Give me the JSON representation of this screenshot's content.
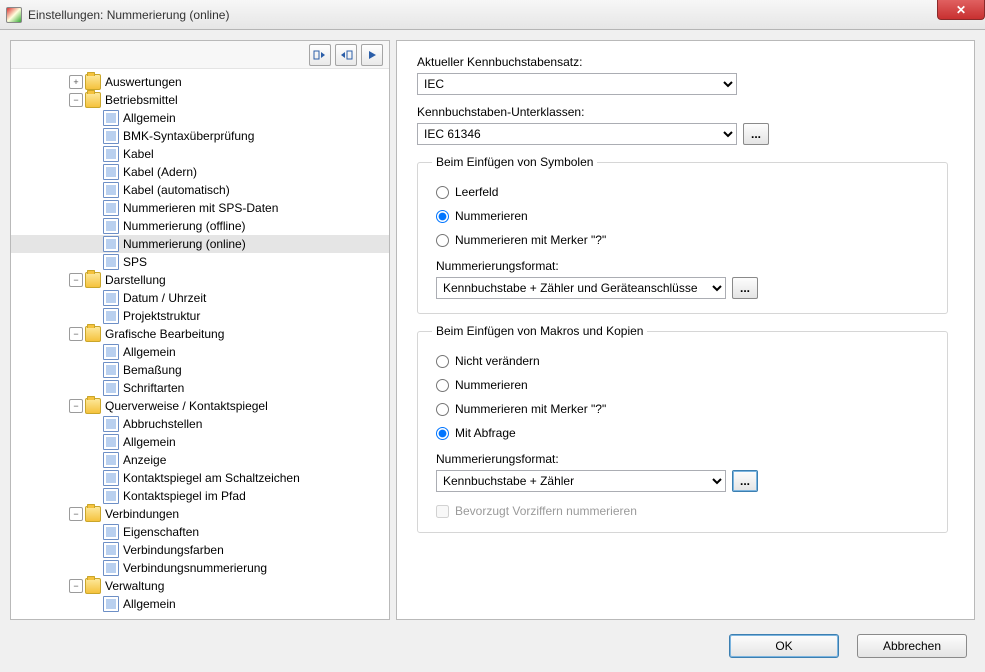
{
  "window": {
    "title": "Einstellungen: Nummerierung (online)",
    "close": "✕"
  },
  "footer": {
    "ok": "OK",
    "cancel": "Abbrechen"
  },
  "tree": [
    {
      "d": 0,
      "tgl": "+",
      "ico": "folder",
      "label": "Auswertungen"
    },
    {
      "d": 0,
      "tgl": "-",
      "ico": "folder",
      "label": "Betriebsmittel"
    },
    {
      "d": 1,
      "tgl": "",
      "ico": "item",
      "label": "Allgemein"
    },
    {
      "d": 1,
      "tgl": "",
      "ico": "item",
      "label": "BMK-Syntaxüberprüfung"
    },
    {
      "d": 1,
      "tgl": "",
      "ico": "item",
      "label": "Kabel"
    },
    {
      "d": 1,
      "tgl": "",
      "ico": "item",
      "label": "Kabel (Adern)"
    },
    {
      "d": 1,
      "tgl": "",
      "ico": "item",
      "label": "Kabel (automatisch)"
    },
    {
      "d": 1,
      "tgl": "",
      "ico": "item",
      "label": "Nummerieren mit SPS-Daten"
    },
    {
      "d": 1,
      "tgl": "",
      "ico": "item",
      "label": "Nummerierung (offline)"
    },
    {
      "d": 1,
      "tgl": "",
      "ico": "item",
      "label": "Nummerierung (online)",
      "sel": true
    },
    {
      "d": 1,
      "tgl": "",
      "ico": "item",
      "label": "SPS"
    },
    {
      "d": 0,
      "tgl": "-",
      "ico": "folder",
      "label": "Darstellung"
    },
    {
      "d": 1,
      "tgl": "",
      "ico": "item",
      "label": "Datum / Uhrzeit"
    },
    {
      "d": 1,
      "tgl": "",
      "ico": "item",
      "label": "Projektstruktur"
    },
    {
      "d": 0,
      "tgl": "-",
      "ico": "folder",
      "label": "Grafische Bearbeitung"
    },
    {
      "d": 1,
      "tgl": "",
      "ico": "item",
      "label": "Allgemein"
    },
    {
      "d": 1,
      "tgl": "",
      "ico": "item",
      "label": "Bemaßung"
    },
    {
      "d": 1,
      "tgl": "",
      "ico": "item",
      "label": "Schriftarten"
    },
    {
      "d": 0,
      "tgl": "-",
      "ico": "folder",
      "label": "Querverweise / Kontaktspiegel"
    },
    {
      "d": 1,
      "tgl": "",
      "ico": "item",
      "label": "Abbruchstellen"
    },
    {
      "d": 1,
      "tgl": "",
      "ico": "item",
      "label": "Allgemein"
    },
    {
      "d": 1,
      "tgl": "",
      "ico": "item",
      "label": "Anzeige"
    },
    {
      "d": 1,
      "tgl": "",
      "ico": "item",
      "label": "Kontaktspiegel am Schaltzeichen"
    },
    {
      "d": 1,
      "tgl": "",
      "ico": "item",
      "label": "Kontaktspiegel im Pfad"
    },
    {
      "d": 0,
      "tgl": "-",
      "ico": "folder",
      "label": "Verbindungen"
    },
    {
      "d": 1,
      "tgl": "",
      "ico": "item",
      "label": "Eigenschaften"
    },
    {
      "d": 1,
      "tgl": "",
      "ico": "item",
      "label": "Verbindungsfarben"
    },
    {
      "d": 1,
      "tgl": "",
      "ico": "item",
      "label": "Verbindungsnummerierung"
    },
    {
      "d": 0,
      "tgl": "-",
      "ico": "folder",
      "label": "Verwaltung"
    },
    {
      "d": 1,
      "tgl": "",
      "ico": "item",
      "label": "Allgemein"
    }
  ],
  "panel": {
    "identset_label": "Aktueller Kennbuchstabensatz:",
    "identset_value": "IEC",
    "subclass_label": "Kennbuchstaben-Unterklassen:",
    "subclass_value": "IEC 61346",
    "group_symbols": {
      "legend": "Beim Einfügen von Symbolen",
      "r1": "Leerfeld",
      "r2": "Nummerieren",
      "r3": "Nummerieren mit Merker \"?\"",
      "format_label": "Nummerierungsformat:",
      "format_value": "Kennbuchstabe + Zähler und Geräteanschlüsse"
    },
    "group_macros": {
      "legend": "Beim Einfügen von Makros und Kopien",
      "r1": "Nicht verändern",
      "r2": "Nummerieren",
      "r3": "Nummerieren mit Merker \"?\"",
      "r4": "Mit Abfrage",
      "format_label": "Nummerierungsformat:",
      "format_value": "Kennbuchstabe + Zähler",
      "chk": "Bevorzugt Vorziffern nummerieren"
    },
    "ellipsis": "..."
  }
}
